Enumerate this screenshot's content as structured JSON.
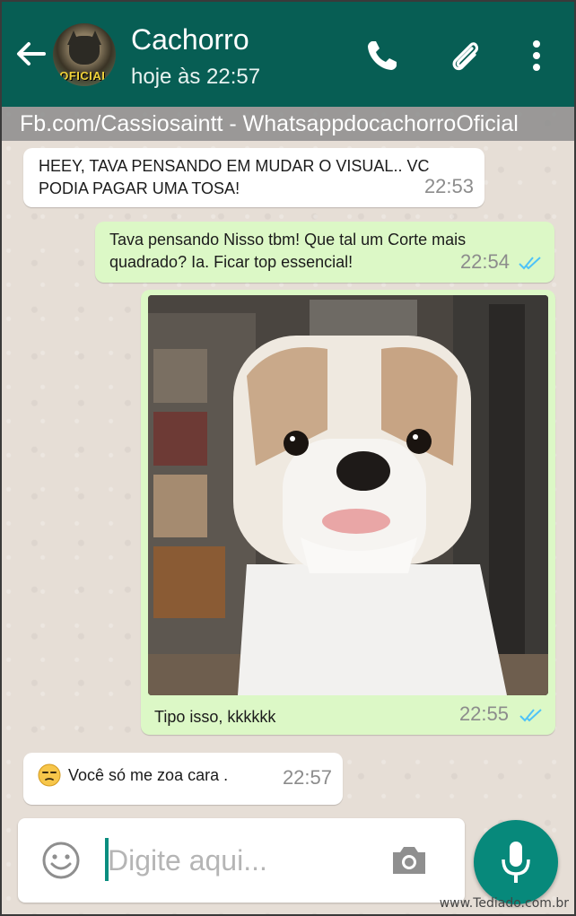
{
  "header": {
    "contact_name": "Cachorro",
    "status": "hoje às 22:57",
    "avatar_tag": "OFICIAL",
    "icons": [
      "back-arrow-icon",
      "phone-icon",
      "paperclip-icon",
      "more-vert-icon"
    ]
  },
  "watermark_bar": "Fb.com/Cassiosaintt -  WhatsappdocachorroOficial",
  "messages": [
    {
      "direction": "in",
      "text": "HEEY,  TAVA PENSANDO EM MUDAR O VISUAL.. VC PODIA PAGAR UMA TOSA!",
      "time": "22:53"
    },
    {
      "direction": "out",
      "text": "Tava pensando Nisso tbm!  Que tal um Corte mais quadrado?  Ia. Ficar top essencial!",
      "time": "22:54",
      "status": "read"
    },
    {
      "direction": "out",
      "type": "image",
      "image_alt": "dog-with-square-haircut",
      "text": "Tipo isso,  kkkkkk",
      "time": "22:55",
      "status": "read"
    },
    {
      "direction": "in",
      "emoji": "unamused-face",
      "text": "Você só me zoa cara .",
      "time": "22:57"
    }
  ],
  "composer": {
    "placeholder": "Digite aqui...",
    "icons": [
      "emoji-icon",
      "camera-icon",
      "mic-icon"
    ]
  },
  "site_watermark": "www.Tediado.com.br",
  "colors": {
    "header": "#075e54",
    "outgoing_bubble": "#dcf8c6",
    "incoming_bubble": "#ffffff",
    "read_ticks": "#4fc3f7",
    "mic_button": "#07897b"
  }
}
